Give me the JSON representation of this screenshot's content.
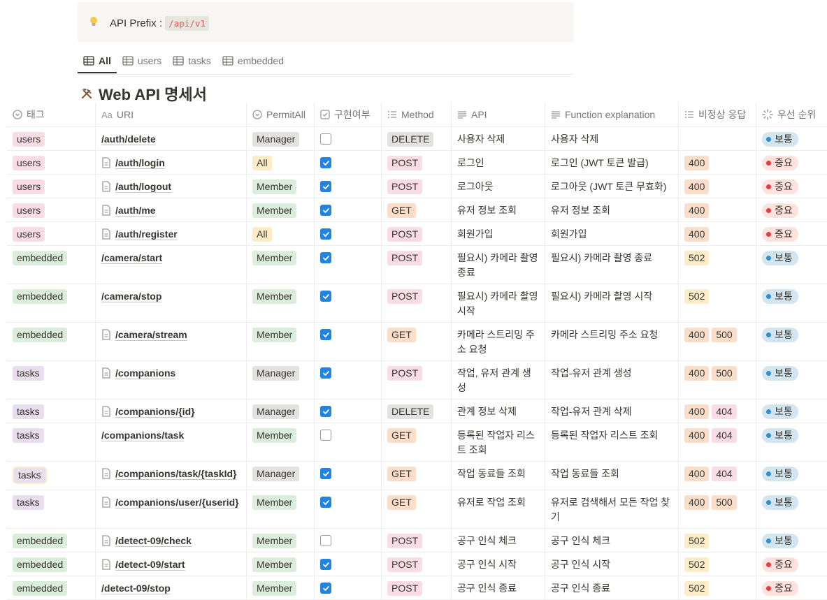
{
  "callout": {
    "label": "API Prefix : ",
    "code": "/api/v1"
  },
  "tabs": [
    {
      "label": "All"
    },
    {
      "label": "users"
    },
    {
      "label": "tasks"
    },
    {
      "label": "embedded"
    }
  ],
  "db_title": "Web API 명세서",
  "columns": [
    "태그",
    "URI",
    "PermitAll",
    "구현여부",
    "Method",
    "API",
    "Function explanation",
    "비정상 응답",
    "우선 순위"
  ],
  "colors": {
    "tag": {
      "users": "#fadce6",
      "embedded": "#dbeddb",
      "tasks": "#e8deee"
    },
    "permit": {
      "Manager": "#e3e2e0",
      "Member": "#dbeddb",
      "All": "#fdecc8"
    },
    "method": {
      "DELETE": "#e3e2e0",
      "POST": "#fadce6",
      "GET": "#fadec9"
    },
    "code": {
      "400": "#fadec9",
      "404": "#fadce6",
      "500": "#fadec9",
      "502": "#fdecc8"
    },
    "prio": {
      "보통": {
        "bg": "#d3e5ef",
        "dot": "#2e8fcc"
      },
      "중요": {
        "bg": "#ffe2dd",
        "dot": "#e03e3e"
      }
    }
  },
  "rows": [
    {
      "tag": "users",
      "uri": "/auth/delete",
      "doc": false,
      "permit": "Manager",
      "done": false,
      "method": "DELETE",
      "api": "사용자 삭제",
      "fn": "사용자 삭제",
      "codes": [],
      "prio": "보통",
      "h": 34
    },
    {
      "tag": "users",
      "uri": "/auth/login",
      "doc": true,
      "permit": "All",
      "done": true,
      "method": "POST",
      "api": "로그인",
      "fn": "로그인 (JWT 토큰 발급)",
      "codes": [
        "400"
      ],
      "prio": "중요",
      "h": 34
    },
    {
      "tag": "users",
      "uri": "/auth/logout",
      "doc": true,
      "permit": "Member",
      "done": true,
      "method": "POST",
      "api": "로그아웃",
      "fn": "로그아웃 (JWT 토큰 무효화)",
      "codes": [
        "400"
      ],
      "prio": "중요",
      "h": 34
    },
    {
      "tag": "users",
      "uri": "/auth/me",
      "doc": true,
      "permit": "Member",
      "done": true,
      "method": "GET",
      "api": "유저 정보 조회",
      "fn": "유저 정보 조회",
      "codes": [
        "400"
      ],
      "prio": "중요",
      "h": 34
    },
    {
      "tag": "users",
      "uri": "/auth/register",
      "doc": true,
      "permit": "All",
      "done": true,
      "method": "POST",
      "api": "회원가입",
      "fn": "회원가입",
      "codes": [
        "400"
      ],
      "prio": "중요",
      "h": 34
    },
    {
      "tag": "embedded",
      "uri": "/camera/start",
      "doc": false,
      "permit": "Member",
      "done": true,
      "method": "POST",
      "api": "필요시) 카메라 촬영 종료",
      "fn": "필요시) 카메라 촬영 종료",
      "codes": [
        "502"
      ],
      "prio": "보통",
      "h": 55
    },
    {
      "tag": "embedded",
      "uri": "/camera/stop",
      "doc": false,
      "permit": "Member",
      "done": true,
      "method": "POST",
      "api": "필요시) 카메라 촬영 시작",
      "fn": "필요시) 카메라 촬영 시작",
      "codes": [
        "502"
      ],
      "prio": "보통",
      "h": 55
    },
    {
      "tag": "embedded",
      "uri": "/camera/stream",
      "doc": true,
      "permit": "Member",
      "done": true,
      "method": "GET",
      "api": "카메라 스트리밍 주소 요청",
      "fn": "카메라 스트리밍 주소 요청",
      "codes": [
        "400",
        "500"
      ],
      "prio": "보통",
      "h": 55
    },
    {
      "tag": "tasks",
      "uri": "/companions",
      "doc": true,
      "permit": "Manager",
      "done": true,
      "method": "POST",
      "api": "작업, 유저 관계 생성",
      "fn": "작업-유저 관계 생성",
      "codes": [
        "400",
        "500"
      ],
      "prio": "보통",
      "h": 55
    },
    {
      "tag": "tasks",
      "uri": "/companions/{id}",
      "doc": true,
      "permit": "Manager",
      "done": true,
      "method": "DELETE",
      "api": "관계 정보 삭제",
      "fn": "작업-유저 관계 삭제",
      "codes": [
        "400",
        "404"
      ],
      "prio": "보통",
      "h": 34
    },
    {
      "tag": "tasks",
      "uri": "/companions/task",
      "doc": false,
      "permit": "Member",
      "done": false,
      "method": "GET",
      "api": "등록된 작업자 리스트 조회",
      "fn": "등록된 작업자 리스트 조회",
      "codes": [
        "400",
        "404"
      ],
      "prio": "보통",
      "h": 55
    },
    {
      "tag": "tasks",
      "uri": "/companions/task/{taskId}",
      "doc": true,
      "permit": "Manager",
      "done": true,
      "method": "GET",
      "api": "작업 동료들 조회",
      "fn": "작업 동료들 조회",
      "codes": [
        "400",
        "404"
      ],
      "prio": "보통",
      "h": 41,
      "highlight": true
    },
    {
      "tag": "tasks",
      "uri": "/companions/user/{userid}",
      "doc": true,
      "permit": "Member",
      "done": true,
      "method": "GET",
      "api": "유저로 작업 조회",
      "fn": "유저로 검색해서 모든 작업 찾기",
      "codes": [
        "400",
        "500"
      ],
      "prio": "보통",
      "h": 55
    },
    {
      "tag": "embedded",
      "uri": "/detect-09/check",
      "doc": true,
      "permit": "Member",
      "done": false,
      "method": "POST",
      "api": "공구 인식 체크",
      "fn": "공구 인식 체크",
      "codes": [
        "502"
      ],
      "prio": "보통",
      "h": 34
    },
    {
      "tag": "embedded",
      "uri": "/detect-09/start",
      "doc": true,
      "permit": "Member",
      "done": true,
      "method": "POST",
      "api": "공구 인식 시작",
      "fn": "공구 인식 시작",
      "codes": [
        "502"
      ],
      "prio": "중요",
      "h": 34
    },
    {
      "tag": "embedded",
      "uri": "/detect-09/stop",
      "doc": false,
      "permit": "Member",
      "done": true,
      "method": "POST",
      "api": "공구 인식 종료",
      "fn": "공구 인식 종료",
      "codes": [
        "502"
      ],
      "prio": "중요",
      "h": 34
    }
  ]
}
